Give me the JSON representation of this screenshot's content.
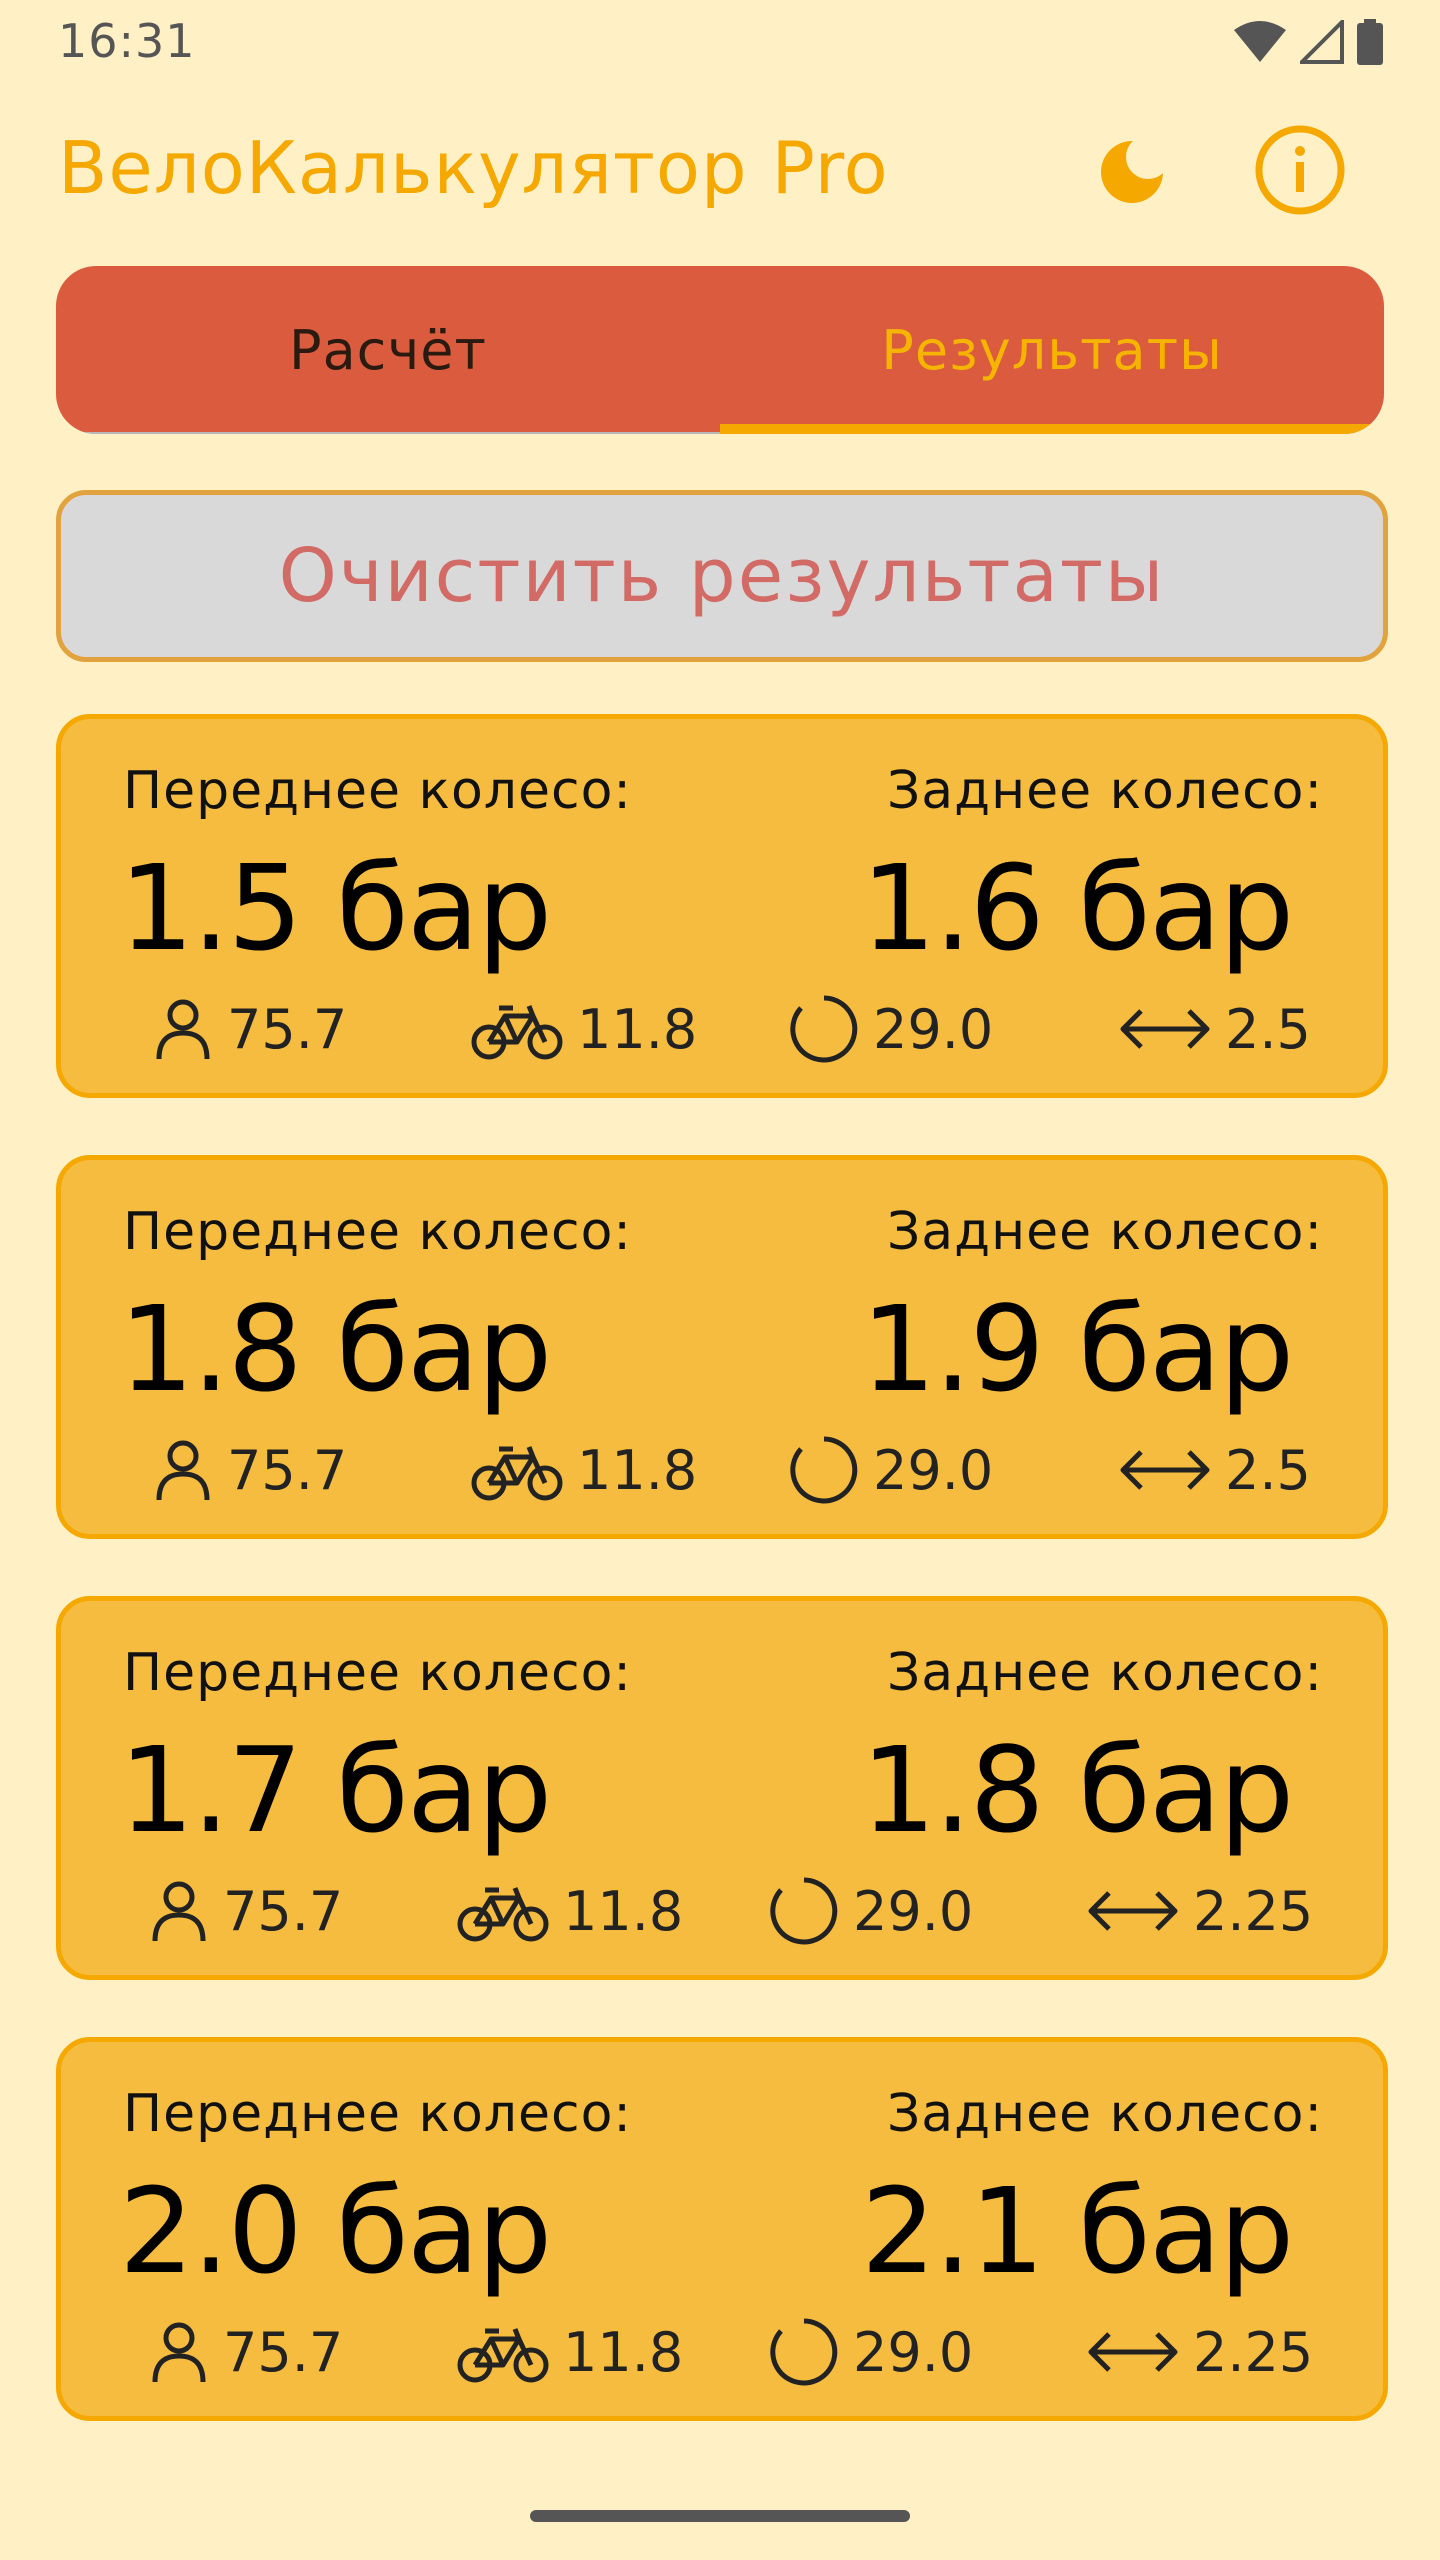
{
  "status_bar": {
    "time": "16:31"
  },
  "app_bar": {
    "title": "ВелоКалькулятор Pro"
  },
  "tabs": [
    {
      "label": "Расчёт",
      "selected": false
    },
    {
      "label": "Результаты",
      "selected": true
    }
  ],
  "clear_button": {
    "label": "Очистить результаты"
  },
  "results": [
    {
      "front_label": "Переднее колесо:",
      "rear_label": "Заднее колесо:",
      "front": "1.5 бар",
      "rear": "1.6 бар",
      "rider": "75.7",
      "bike": "11.8",
      "wheel": "29.0",
      "width": "2.5"
    },
    {
      "front_label": "Переднее колесо:",
      "rear_label": "Заднее колесо:",
      "front": "1.8 бар",
      "rear": "1.9 бар",
      "rider": "75.7",
      "bike": "11.8",
      "wheel": "29.0",
      "width": "2.5"
    },
    {
      "front_label": "Переднее колесо:",
      "rear_label": "Заднее колесо:",
      "front": "1.7 бар",
      "rear": "1.8 бар",
      "rider": "75.7",
      "bike": "11.8",
      "wheel": "29.0",
      "width": "2.25"
    },
    {
      "front_label": "Переднее колесо:",
      "rear_label": "Заднее колесо:",
      "front": "2.0 бар",
      "rear": "2.1 бар",
      "rider": "75.7",
      "bike": "11.8",
      "wheel": "29.0",
      "width": "2.25"
    }
  ],
  "colors": {
    "background": "#FFF1C5",
    "accent": "#F5A800",
    "tab_bar": "#DB5B3F",
    "card": "#F5BC3F",
    "clear_text": "#D26A66"
  },
  "icons": [
    "wifi-icon",
    "signal-icon",
    "battery-icon",
    "dark-mode-icon",
    "info-icon",
    "person-icon",
    "bicycle-icon",
    "wheel-circle-icon",
    "width-arrows-icon"
  ]
}
